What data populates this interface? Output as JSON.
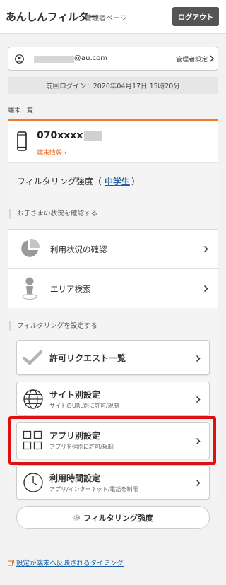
{
  "header": {
    "brand": "あんしんフィルター",
    "subtitle": "管理者ページ",
    "logout_label": "ログアウト"
  },
  "account": {
    "email_suffix": "@au.com",
    "admin_settings_label": "管理者設定"
  },
  "last_login": "前回ログイン：2020年04月17日 15時20分",
  "devices_label": "端末一覧",
  "device": {
    "number": "070xxxx",
    "info_link": "端末情報 ›"
  },
  "filter_strength": {
    "label": "フィルタリング強度（",
    "level": "中学生",
    "close": "）"
  },
  "status_section": {
    "label": "お子さまの状況を確認する",
    "items": [
      {
        "title": "利用状況の確認",
        "icon": "pie-chart-icon"
      },
      {
        "title": "エリア検索",
        "icon": "location-person-icon"
      }
    ]
  },
  "filter_section": {
    "label": "フィルタリングを設定する",
    "tiles": [
      {
        "title": "許可リクエスト一覧",
        "desc": "",
        "icon": "checkmark-icon"
      },
      {
        "title": "サイト別設定",
        "desc": "サイトのURL別に許可/規制",
        "icon": "globe-icon"
      },
      {
        "title": "アプリ別設定",
        "desc": "アプリを個別に許可/規制",
        "icon": "app-grid-icon"
      },
      {
        "title": "利用時間設定",
        "desc": "アプリ/インターネット/電話を制限",
        "icon": "clock-icon"
      }
    ]
  },
  "strength_button": "フィルタリング強度",
  "bottom_link": "設定が端末へ反映されるタイミング",
  "colors": {
    "accent": "#f07a28",
    "link": "#1a5fa8",
    "highlight": "#e01010",
    "logout_bg": "#555555"
  }
}
